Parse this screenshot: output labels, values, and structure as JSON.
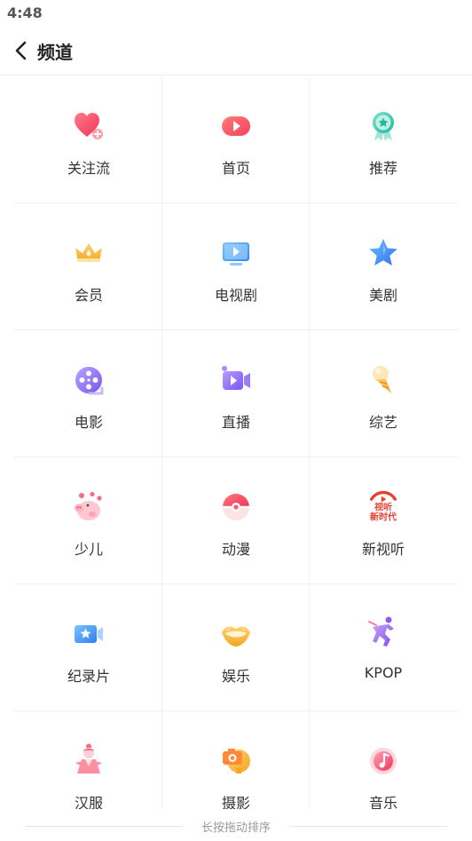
{
  "status_bar": {
    "time": "4:48"
  },
  "header": {
    "title": "频道"
  },
  "channels": [
    {
      "label": "关注流",
      "icon": "heart-plus-icon"
    },
    {
      "label": "首页",
      "icon": "play-icon"
    },
    {
      "label": "推荐",
      "icon": "medal-star-icon"
    },
    {
      "label": "会员",
      "icon": "crown-icon"
    },
    {
      "label": "电视剧",
      "icon": "tv-icon"
    },
    {
      "label": "美剧",
      "icon": "star-icon"
    },
    {
      "label": "电影",
      "icon": "film-reel-icon"
    },
    {
      "label": "直播",
      "icon": "video-camera-icon"
    },
    {
      "label": "综艺",
      "icon": "ice-cream-icon"
    },
    {
      "label": "少儿",
      "icon": "pig-icon"
    },
    {
      "label": "动漫",
      "icon": "pokeball-icon"
    },
    {
      "label": "新视听",
      "icon": "new-audio-visual-logo-icon",
      "logo_text": "视听 新时代"
    },
    {
      "label": "纪录片",
      "icon": "documentary-camera-icon"
    },
    {
      "label": "娱乐",
      "icon": "lips-icon"
    },
    {
      "label": "KPOP",
      "icon": "dancer-icon"
    },
    {
      "label": "汉服",
      "icon": "hanfu-girl-icon"
    },
    {
      "label": "摄影",
      "icon": "photo-camera-icon"
    },
    {
      "label": "音乐",
      "icon": "music-note-icon"
    }
  ],
  "footer": {
    "hint": "长按拖动排序"
  },
  "colors": {
    "accent_red": "#f0506e",
    "accent_blue": "#4a90f5",
    "accent_purple": "#8a6cf0",
    "accent_orange": "#f5a623",
    "accent_teal": "#3cc7b0",
    "divider": "#f0f0f0"
  }
}
